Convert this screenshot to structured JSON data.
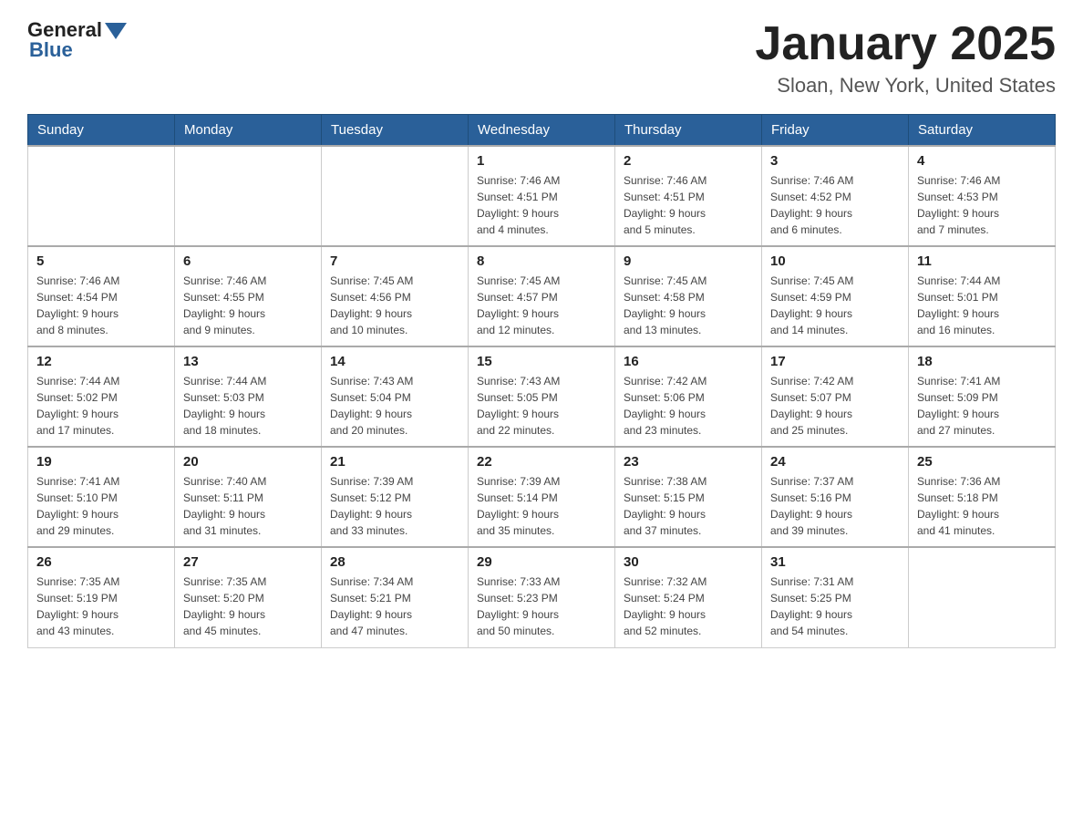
{
  "header": {
    "logo": {
      "general": "General",
      "blue": "Blue"
    },
    "title": "January 2025",
    "subtitle": "Sloan, New York, United States"
  },
  "days_of_week": [
    "Sunday",
    "Monday",
    "Tuesday",
    "Wednesday",
    "Thursday",
    "Friday",
    "Saturday"
  ],
  "weeks": [
    [
      {
        "day": "",
        "info": ""
      },
      {
        "day": "",
        "info": ""
      },
      {
        "day": "",
        "info": ""
      },
      {
        "day": "1",
        "info": "Sunrise: 7:46 AM\nSunset: 4:51 PM\nDaylight: 9 hours\nand 4 minutes."
      },
      {
        "day": "2",
        "info": "Sunrise: 7:46 AM\nSunset: 4:51 PM\nDaylight: 9 hours\nand 5 minutes."
      },
      {
        "day": "3",
        "info": "Sunrise: 7:46 AM\nSunset: 4:52 PM\nDaylight: 9 hours\nand 6 minutes."
      },
      {
        "day": "4",
        "info": "Sunrise: 7:46 AM\nSunset: 4:53 PM\nDaylight: 9 hours\nand 7 minutes."
      }
    ],
    [
      {
        "day": "5",
        "info": "Sunrise: 7:46 AM\nSunset: 4:54 PM\nDaylight: 9 hours\nand 8 minutes."
      },
      {
        "day": "6",
        "info": "Sunrise: 7:46 AM\nSunset: 4:55 PM\nDaylight: 9 hours\nand 9 minutes."
      },
      {
        "day": "7",
        "info": "Sunrise: 7:45 AM\nSunset: 4:56 PM\nDaylight: 9 hours\nand 10 minutes."
      },
      {
        "day": "8",
        "info": "Sunrise: 7:45 AM\nSunset: 4:57 PM\nDaylight: 9 hours\nand 12 minutes."
      },
      {
        "day": "9",
        "info": "Sunrise: 7:45 AM\nSunset: 4:58 PM\nDaylight: 9 hours\nand 13 minutes."
      },
      {
        "day": "10",
        "info": "Sunrise: 7:45 AM\nSunset: 4:59 PM\nDaylight: 9 hours\nand 14 minutes."
      },
      {
        "day": "11",
        "info": "Sunrise: 7:44 AM\nSunset: 5:01 PM\nDaylight: 9 hours\nand 16 minutes."
      }
    ],
    [
      {
        "day": "12",
        "info": "Sunrise: 7:44 AM\nSunset: 5:02 PM\nDaylight: 9 hours\nand 17 minutes."
      },
      {
        "day": "13",
        "info": "Sunrise: 7:44 AM\nSunset: 5:03 PM\nDaylight: 9 hours\nand 18 minutes."
      },
      {
        "day": "14",
        "info": "Sunrise: 7:43 AM\nSunset: 5:04 PM\nDaylight: 9 hours\nand 20 minutes."
      },
      {
        "day": "15",
        "info": "Sunrise: 7:43 AM\nSunset: 5:05 PM\nDaylight: 9 hours\nand 22 minutes."
      },
      {
        "day": "16",
        "info": "Sunrise: 7:42 AM\nSunset: 5:06 PM\nDaylight: 9 hours\nand 23 minutes."
      },
      {
        "day": "17",
        "info": "Sunrise: 7:42 AM\nSunset: 5:07 PM\nDaylight: 9 hours\nand 25 minutes."
      },
      {
        "day": "18",
        "info": "Sunrise: 7:41 AM\nSunset: 5:09 PM\nDaylight: 9 hours\nand 27 minutes."
      }
    ],
    [
      {
        "day": "19",
        "info": "Sunrise: 7:41 AM\nSunset: 5:10 PM\nDaylight: 9 hours\nand 29 minutes."
      },
      {
        "day": "20",
        "info": "Sunrise: 7:40 AM\nSunset: 5:11 PM\nDaylight: 9 hours\nand 31 minutes."
      },
      {
        "day": "21",
        "info": "Sunrise: 7:39 AM\nSunset: 5:12 PM\nDaylight: 9 hours\nand 33 minutes."
      },
      {
        "day": "22",
        "info": "Sunrise: 7:39 AM\nSunset: 5:14 PM\nDaylight: 9 hours\nand 35 minutes."
      },
      {
        "day": "23",
        "info": "Sunrise: 7:38 AM\nSunset: 5:15 PM\nDaylight: 9 hours\nand 37 minutes."
      },
      {
        "day": "24",
        "info": "Sunrise: 7:37 AM\nSunset: 5:16 PM\nDaylight: 9 hours\nand 39 minutes."
      },
      {
        "day": "25",
        "info": "Sunrise: 7:36 AM\nSunset: 5:18 PM\nDaylight: 9 hours\nand 41 minutes."
      }
    ],
    [
      {
        "day": "26",
        "info": "Sunrise: 7:35 AM\nSunset: 5:19 PM\nDaylight: 9 hours\nand 43 minutes."
      },
      {
        "day": "27",
        "info": "Sunrise: 7:35 AM\nSunset: 5:20 PM\nDaylight: 9 hours\nand 45 minutes."
      },
      {
        "day": "28",
        "info": "Sunrise: 7:34 AM\nSunset: 5:21 PM\nDaylight: 9 hours\nand 47 minutes."
      },
      {
        "day": "29",
        "info": "Sunrise: 7:33 AM\nSunset: 5:23 PM\nDaylight: 9 hours\nand 50 minutes."
      },
      {
        "day": "30",
        "info": "Sunrise: 7:32 AM\nSunset: 5:24 PM\nDaylight: 9 hours\nand 52 minutes."
      },
      {
        "day": "31",
        "info": "Sunrise: 7:31 AM\nSunset: 5:25 PM\nDaylight: 9 hours\nand 54 minutes."
      },
      {
        "day": "",
        "info": ""
      }
    ]
  ]
}
